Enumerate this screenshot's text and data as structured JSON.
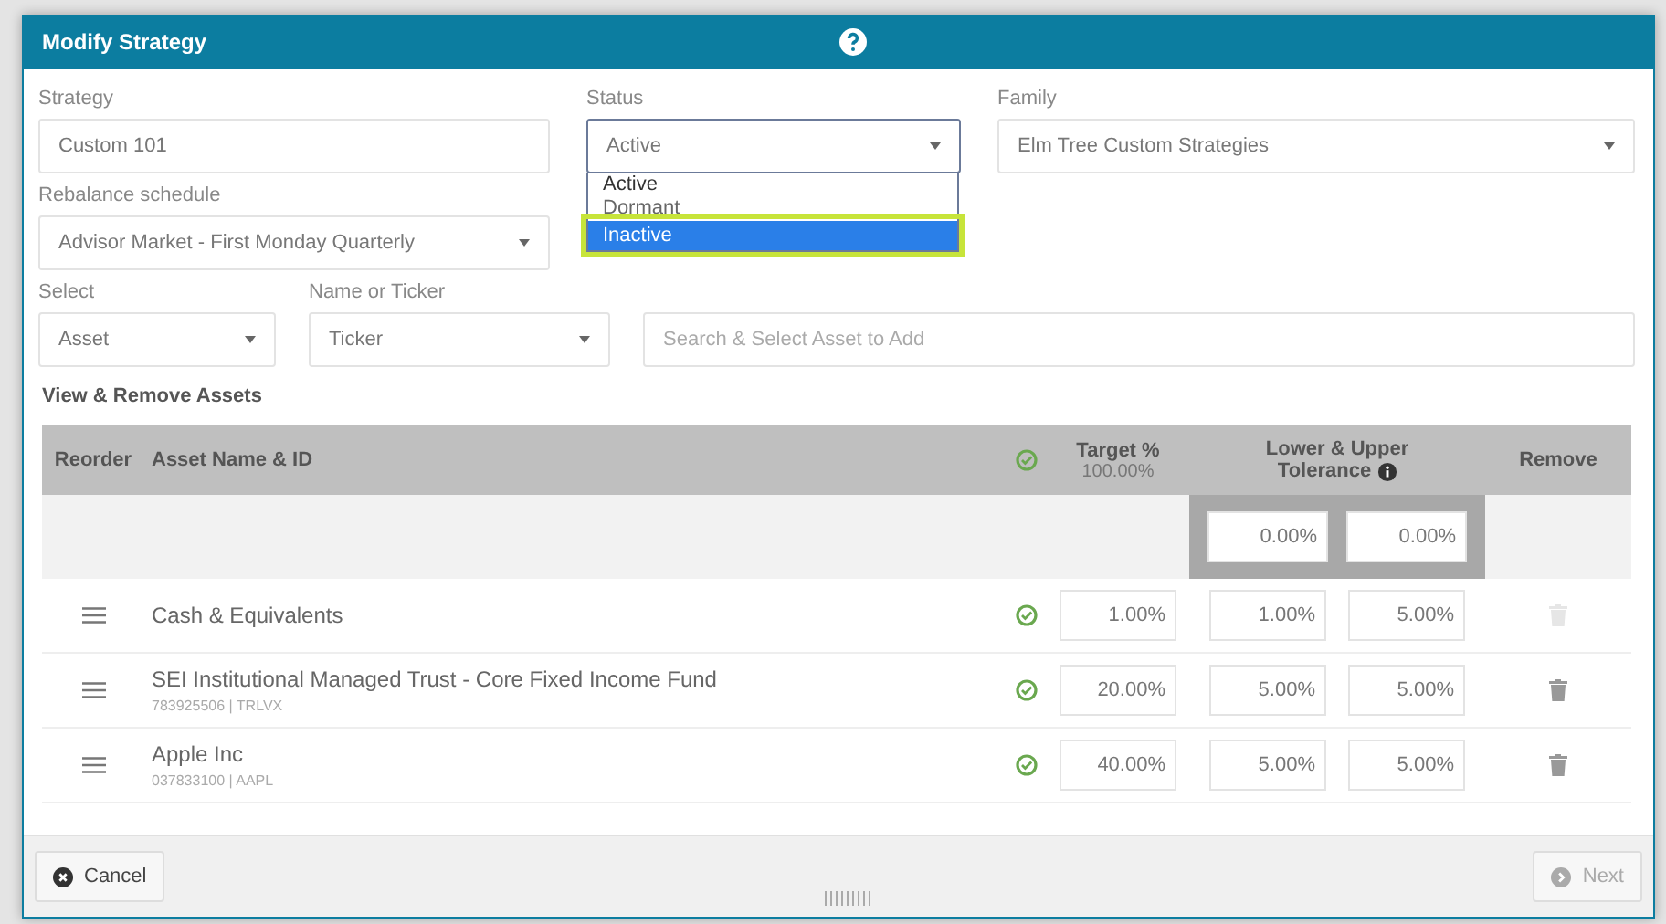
{
  "dialog": {
    "title": "Modify Strategy"
  },
  "strategy": {
    "label": "Strategy",
    "value": "Custom 101"
  },
  "status": {
    "label": "Status",
    "value": "Active",
    "expanded": true,
    "options": [
      {
        "label": "Active",
        "selected": true,
        "highlighted": false
      },
      {
        "label": "Dormant",
        "selected": false,
        "highlighted": false
      },
      {
        "label": "Inactive",
        "selected": false,
        "highlighted": true
      }
    ]
  },
  "family": {
    "label": "Family",
    "value": "Elm Tree Custom Strategies"
  },
  "rebalance": {
    "label": "Rebalance schedule",
    "value": "Advisor Market - First Monday Quarterly"
  },
  "select": {
    "label": "Select",
    "value": "Asset"
  },
  "name_or_ticker": {
    "label": "Name or Ticker",
    "value": "Ticker"
  },
  "search": {
    "placeholder": "Search & Select Asset to Add"
  },
  "section_title": "View & Remove Assets",
  "table": {
    "columns": {
      "reorder": "Reorder",
      "asset": "Asset Name & ID",
      "target": "Target %",
      "target_total": "100.00%",
      "tolerance_line1": "Lower & Upper",
      "tolerance_line2": "Tolerance",
      "remove": "Remove"
    },
    "default_tolerance": {
      "lower": "0.00%",
      "upper": "0.00%"
    },
    "rows": [
      {
        "name": "Cash & Equivalents",
        "target": "1.00%",
        "lower": "1.00%",
        "upper": "5.00%",
        "removable": false
      },
      {
        "name": "SEI Institutional Managed Trust - Core Fixed Income Fund",
        "id": "783925506 | TRLVX",
        "target": "20.00%",
        "lower": "5.00%",
        "upper": "5.00%",
        "removable": true
      },
      {
        "name": "Apple Inc",
        "id": "037833100 | AAPL",
        "target": "40.00%",
        "lower": "5.00%",
        "upper": "5.00%",
        "removable": true
      }
    ]
  },
  "footer": {
    "cancel": "Cancel",
    "next": "Next",
    "next_disabled": true
  }
}
